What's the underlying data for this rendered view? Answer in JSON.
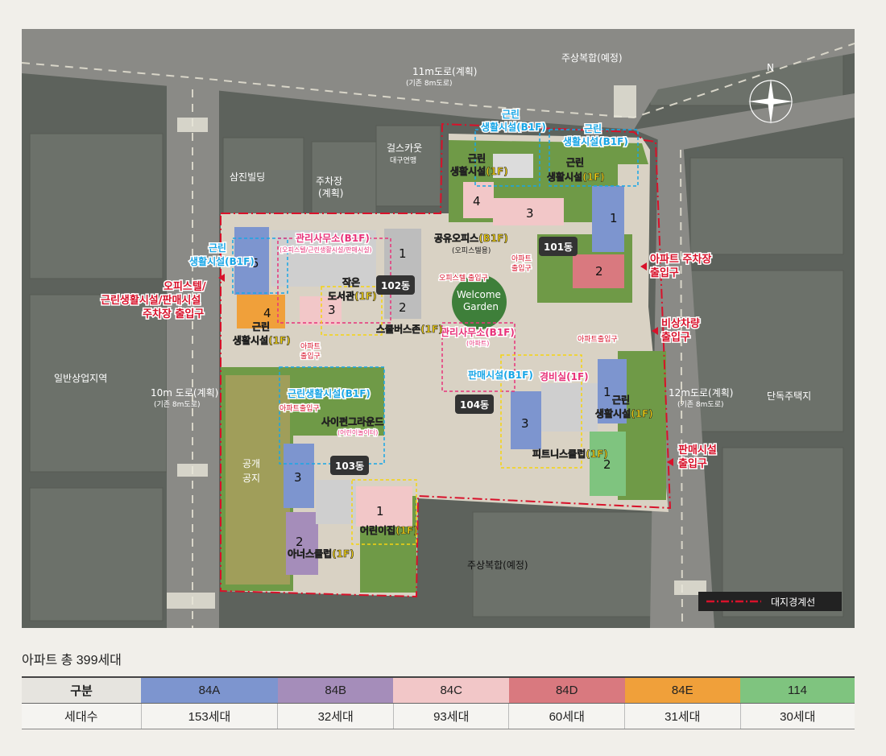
{
  "map": {
    "roads": {
      "north": {
        "name": "11m도로(계획)",
        "note": "(기존 8m도로)"
      },
      "west": {
        "name": "10m 도로(계획)",
        "note": "(기존 8m도로)"
      },
      "east": {
        "name": "12m도로(계획)",
        "note": "(기존 8m도로)"
      }
    },
    "surroundings": {
      "mixed_use_north": "주상복합(예정)",
      "mixed_use_south": "주상복합(예정)",
      "samjin": "삼진빌딩",
      "parking_lot_1": "주차장",
      "parking_lot_2": "(계획)",
      "scout_1": "걸스카웃",
      "scout_2": "대구연맹",
      "commercial_area": "일반상업지역",
      "detached_housing": "단독주택지",
      "public_open_1": "공개",
      "public_open_2": "공지",
      "compass_n": "N"
    },
    "buildings": {
      "b101": "101동",
      "b102": "102동",
      "b103": "103동",
      "b104": "104동"
    },
    "unit_numbers": {
      "b101_1": "1",
      "b101_2": "2",
      "b101_3": "3",
      "b101_4": "4",
      "b102_1": "1",
      "b102_2": "2",
      "b102_3": "3",
      "b102_4": "4",
      "b102_5": "5",
      "b103_1": "1",
      "b103_2": "2",
      "b103_3": "3",
      "b104_1": "1",
      "b104_2": "2",
      "b104_3": "3"
    },
    "facilities": {
      "nc_b1f_n1": "근린",
      "nc_b1f_n2": "생활시설(B1F)",
      "nc_b1f_ne1": "근린",
      "nc_b1f_ne2": "생활시설(B1F)",
      "nc_1f_a1": "근린",
      "nc_1f_a2": "생활시설(1F)",
      "nc_1f_b1": "근린",
      "nc_1f_b2": "생활시설(1F)",
      "nc_b1f_w1": "근린",
      "nc_b1f_w2": "생활시설(B1F)",
      "nc_1f_w1": "근린",
      "nc_1f_w2": "생활시설(1F)",
      "nc_b1f_c": "근린생활시설(B1F)",
      "nc_1f_e1": "근린",
      "nc_1f_e2": "생활시설(1F)",
      "mgmt_b1f": "관리사무소(B1F)",
      "mgmt_b1f_sub": "(오피스텔/근린생활시설/판매시설)",
      "mgmt_1f": "관리사무소(B1F)",
      "mgmt_1f_sub": "(아파트)",
      "library_1": "작은",
      "library_2": "도서관(1F)",
      "shared_office": "공유오피스(B1F)",
      "shared_office_sub": "(오피스텔용)",
      "school_bus": "스쿨버스존(1F)",
      "welcome_1": "Welcome",
      "welcome_2": "Garden",
      "sales_b1f": "판매시설(B1F)",
      "guard": "경비실(1F)",
      "fitness": "피트니스클럽(1F)",
      "playground": "사이펀그라운드",
      "playground_sub": "(어린이놀이터)",
      "daycare": "어린이집(1F)",
      "senior": "아너스클럽(1F)"
    },
    "entrances": {
      "apt_entrance_w1": "아파트",
      "apt_entrance_w2": "출입구",
      "apt_entrance_n1": "아파트",
      "apt_entrance_n2": "출입구",
      "officetel_entrance": "오피스텔 출입구",
      "apt_entrance_c": "아파트출입구",
      "apt_entrance_e": "아파트출입구",
      "west_1": "오피스텔/",
      "west_2": "근린생활시설/판매시설",
      "west_3": "주차장 출입구",
      "east_parking_1": "아파트 주차장",
      "east_parking_2": "출입구",
      "emergency_1": "비상차량",
      "emergency_2": "출입구",
      "sales_entrance_1": "판매시설",
      "sales_entrance_2": "출입구"
    },
    "legend": {
      "boundary": "대지경계선"
    },
    "colors": {
      "84A": "#7d95cf",
      "84B": "#a58dba",
      "84C": "#f2c7c8",
      "84D": "#d9797f",
      "84E": "#f0a03a",
      "114": "#7fc47f",
      "boundary": "#d8112a"
    }
  },
  "summary": {
    "title": "아파트 총 399세대"
  },
  "table": {
    "header_label": "구분",
    "row_label": "세대수",
    "types": [
      {
        "name": "84A",
        "count": "153세대",
        "color": "#7d95cf"
      },
      {
        "name": "84B",
        "count": "32세대",
        "color": "#a58dba"
      },
      {
        "name": "84C",
        "count": "93세대",
        "color": "#f2c7c8"
      },
      {
        "name": "84D",
        "count": "60세대",
        "color": "#d9797f"
      },
      {
        "name": "84E",
        "count": "31세대",
        "color": "#f0a03a"
      },
      {
        "name": "114",
        "count": "30세대",
        "color": "#7fc47f"
      }
    ]
  }
}
